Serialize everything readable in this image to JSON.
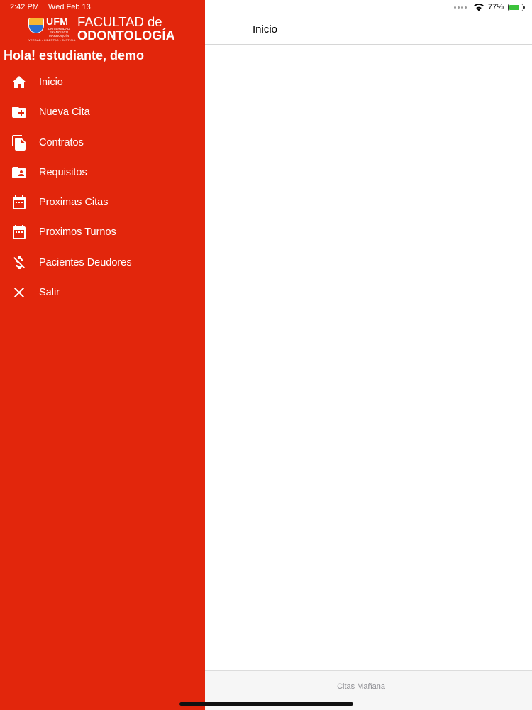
{
  "status_bar": {
    "time": "2:42 PM",
    "date": "Wed Feb 13",
    "battery": "77%",
    "battery_level": 0.77
  },
  "logo": {
    "ufm": "UFM",
    "university": "UNIVERSIDAD FRANCISCO MARROQUÍN",
    "motto": "VERDAD • LIBERTAD • JUSTICIA",
    "faculty_line1": "FACULTAD de",
    "faculty_line2": "ODONTOLOGÍA"
  },
  "greeting": "Hola! estudiante, demo",
  "menu": [
    {
      "label": "Inicio",
      "icon": "home-icon"
    },
    {
      "label": "Nueva Cita",
      "icon": "folder-add-icon"
    },
    {
      "label": "Contratos",
      "icon": "copy-icon"
    },
    {
      "label": "Requisitos",
      "icon": "folder-user-icon"
    },
    {
      "label": "Proximas Citas",
      "icon": "calendar-icon"
    },
    {
      "label": "Proximos Turnos",
      "icon": "calendar-icon"
    },
    {
      "label": "Pacientes Deudores",
      "icon": "money-off-icon"
    },
    {
      "label": "Salir",
      "icon": "close-icon"
    }
  ],
  "main": {
    "title": "Inicio",
    "tab_label": "Citas Mañana"
  },
  "colors": {
    "sidebar": "#e2260c",
    "battery": "#3cc33c"
  }
}
